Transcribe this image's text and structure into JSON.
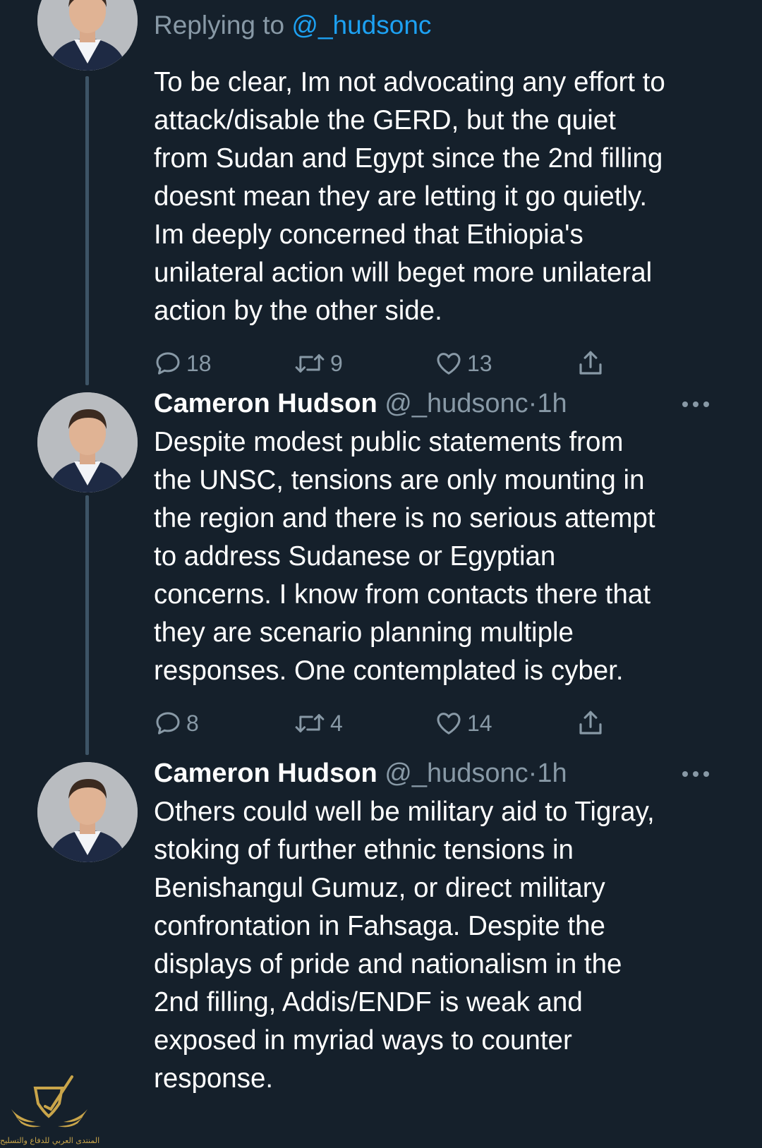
{
  "tweets": [
    {
      "reply_prefix": "Replying to ",
      "reply_handle": "@_hudsonc",
      "lines": [
        "To be clear, Im not advocating any effort to",
        "attack/disable the GERD, but the quiet",
        "from Sudan and Egypt since the 2nd filling",
        "doesnt mean they are letting it go quietly.",
        "Im deeply concerned that Ethiopia's",
        "unilateral action will beget more unilateral",
        "action by the other side."
      ],
      "replies": "18",
      "retweets": "9",
      "likes": "13"
    },
    {
      "author": "Cameron Hudson",
      "handle": "@_hudsonc",
      "separator": "·",
      "time": "1h",
      "lines": [
        "Despite modest public statements from",
        "the UNSC, tensions are only mounting in",
        "the region and there is no serious attempt",
        "to address Sudanese or Egyptian",
        "concerns. I know from contacts there that",
        "they are scenario planning multiple",
        "responses. One contemplated is cyber."
      ],
      "replies": "8",
      "retweets": "4",
      "likes": "14"
    },
    {
      "author": "Cameron Hudson",
      "handle": "@_hudsonc",
      "separator": "·",
      "time": "1h",
      "lines": [
        "Others could well be military aid to Tigray,",
        "stoking of further ethnic tensions in",
        "Benishangul Gumuz, or direct military",
        "confrontation in Fahsaga. Despite the",
        "displays of pride and nationalism in the",
        "2nd filling, Addis/ENDF is weak and",
        "exposed in myriad ways to counter",
        "response."
      ]
    }
  ],
  "watermark": {
    "text": "المنتدى العربي للدفاع والتسليح"
  },
  "icons": {
    "reply": "reply-icon",
    "retweet": "retweet-icon",
    "like": "heart-icon",
    "share": "share-icon",
    "more": "more-icon"
  },
  "colors": {
    "background": "#15202b",
    "text": "#ffffff",
    "secondary": "#8899a6",
    "link": "#1da1f2",
    "thread_line": "#3d5466"
  }
}
